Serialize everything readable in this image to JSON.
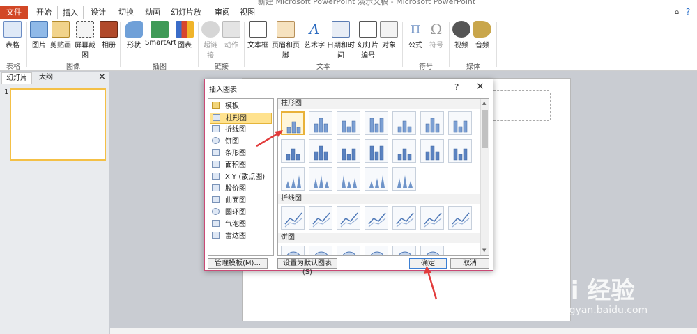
{
  "window": {
    "title": "新建 Microsoft PowerPoint 演示文稿 - Microsoft PowerPoint"
  },
  "tabs": [
    "文件",
    "开始",
    "插入",
    "设计",
    "切换",
    "动画",
    "幻灯片放映",
    "审阅",
    "视图"
  ],
  "ribbon": {
    "buttons": [
      "表格",
      "图片",
      "剪贴画",
      "屏幕截图",
      "相册",
      "形状",
      "SmartArt",
      "图表",
      "超链接",
      "动作",
      "文本框",
      "页眉和页脚",
      "艺术字",
      "日期和时间",
      "幻灯片",
      "编号",
      "对象",
      "公式",
      "符号",
      "视频",
      "音频"
    ],
    "groups": [
      "表格",
      "图像",
      "插图",
      "链接",
      "文本",
      "符号",
      "媒体"
    ]
  },
  "left_panel": {
    "tabs": [
      "幻灯片",
      "大纲"
    ],
    "close": "×",
    "slide_number": "1"
  },
  "dialog": {
    "title": "插入图表",
    "help": "?",
    "close": "×",
    "categories": [
      "模板",
      "柱形图",
      "折线图",
      "饼图",
      "条形图",
      "面积图",
      "X Y (散点图)",
      "股价图",
      "曲面图",
      "圆环图",
      "气泡图",
      "雷达图"
    ],
    "selected_category": "柱形图",
    "sections": [
      "柱形图",
      "折线图",
      "饼图"
    ],
    "buttons": {
      "manage": "管理模板(M)...",
      "set_default": "设置为默认图表(S)",
      "ok": "确定",
      "cancel": "取消"
    }
  },
  "watermark": {
    "brand": "Bai 经验",
    "url": "jingyan.baidu.com"
  },
  "colors": {
    "file_tab": "#d24726",
    "selection": "#ffe28e",
    "dialog_border": "#c94a75",
    "arrow": "#e23b3b"
  }
}
